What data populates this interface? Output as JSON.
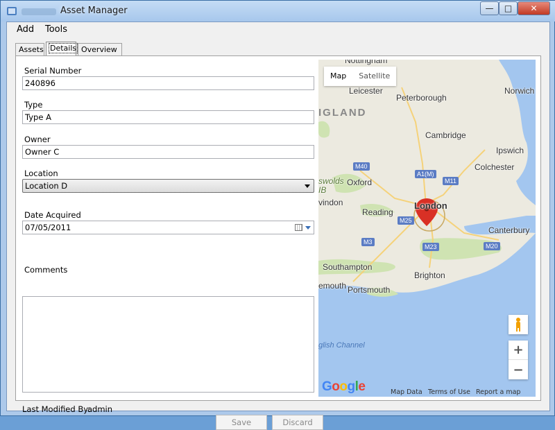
{
  "window": {
    "title": "Asset Manager",
    "minimize_glyph": "—",
    "maximize_glyph": "□",
    "close_glyph": "✕"
  },
  "menu": {
    "add": "Add",
    "tools": "Tools"
  },
  "tabs": {
    "assets": "Assets",
    "details": "Details",
    "overview": "Overview",
    "selected": "Details"
  },
  "form": {
    "serial_label": "Serial Number",
    "serial_value": "240896",
    "type_label": "Type",
    "type_value": "Type A",
    "owner_label": "Owner",
    "owner_value": "Owner C",
    "location_label": "Location",
    "location_value": "Location D",
    "date_label": "Date Acquired",
    "date_value": "07/05/2011",
    "comments_label": "Comments",
    "comments_value": "",
    "last_modified_label": "Last Modified By:",
    "last_modified_value": "admin",
    "save_label": "Save",
    "discard_label": "Discard"
  },
  "map": {
    "map_btn": "Map",
    "satellite_btn": "Satellite",
    "zoom_in": "+",
    "zoom_out": "−",
    "google_logo": "Google",
    "attrib_data": "Map Data",
    "attrib_terms": "Terms of Use",
    "attrib_report": "Report a map error",
    "places": {
      "nottingham": "Nottingham",
      "leicester": "Leicester",
      "peterborough": "Peterborough",
      "norwich": "Norwich",
      "england": "IGLAND",
      "cambridge": "Cambridge",
      "ipswich": "Ipswich",
      "colchester": "Colchester",
      "oxford": "Oxford",
      "cotswolds": "swolds",
      "aonb": "IB",
      "swindon": "vindon",
      "london": "London",
      "reading": "Reading",
      "canterbury": "Canterbury",
      "southampton": "Southampton",
      "brighton": "Brighton",
      "bournemouth": "emouth",
      "portsmouth": "Portsmouth",
      "channel": "glish Channel"
    },
    "roads": {
      "m40": "M40",
      "a1m": "A1(M)",
      "m11": "M11",
      "m25": "M25",
      "m3": "M3",
      "m23": "M23",
      "m20": "M20"
    },
    "colors": {
      "land": "#eceae0",
      "sea": "#a3c6ef",
      "green": "#cfe3b2",
      "pin": "#d93025"
    }
  },
  "icons": {
    "app": "app-icon",
    "calendar": "calendar-icon",
    "pegman": "pegman-icon",
    "pin": "map-pin-icon"
  }
}
